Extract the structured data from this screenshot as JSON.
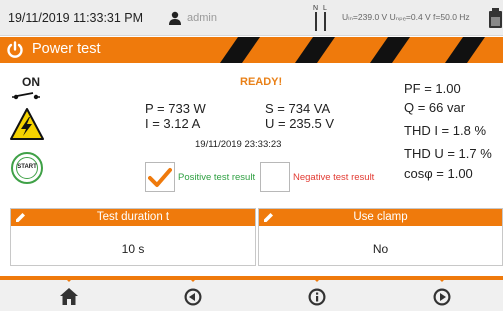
{
  "status": {
    "datetime": "19/11/2019 11:33:31 PM",
    "user": "admin",
    "nl_label": "N L",
    "readings": "Uₗₙ=239.0 V Uₙₚₑ=0.4 V f=50.0 Hz"
  },
  "title": "Power test",
  "main": {
    "switch_label": "ON",
    "start_label": "START",
    "status": "READY!",
    "P": "P = 733 W",
    "I": "I = 3.12 A",
    "S": "S = 734 VA",
    "U": "U = 235.5 V",
    "timestamp": "19/11/2019 23:33:23",
    "positive_label": "Positive test result",
    "negative_label": "Negative test result",
    "positive_checked": true,
    "PF": "PF = 1.00",
    "Q": "Q = 66 var",
    "THD_I": "THD I = 1.8 %",
    "THD_U": "THD U = 1.7 %",
    "cos": "cosφ = 1.00"
  },
  "settings": [
    {
      "title": "Test duration t",
      "value": "10 s"
    },
    {
      "title": "Use clamp",
      "value": "No"
    }
  ],
  "colors": {
    "accent": "#ef7a0c",
    "positive": "#2fa042",
    "negative": "#e23b33"
  },
  "nav": {
    "items": [
      "home-icon",
      "back-icon",
      "info-icon",
      "forward-icon"
    ]
  }
}
